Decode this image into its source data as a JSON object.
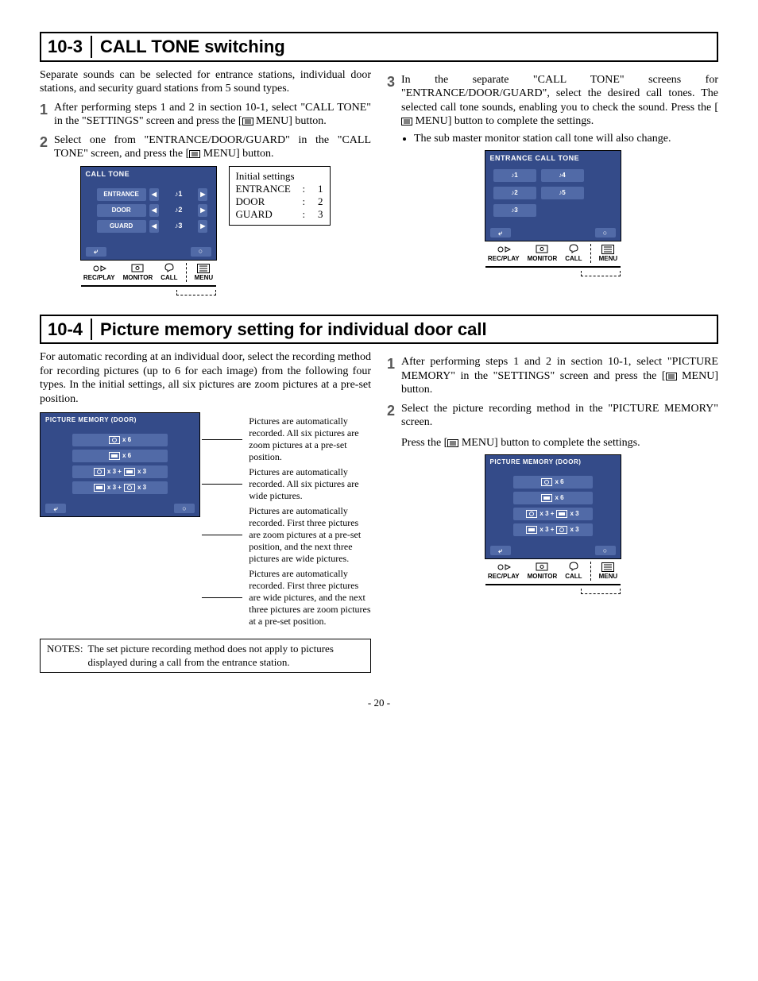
{
  "sec103": {
    "num": "10-3",
    "title": "CALL TONE switching",
    "intro": "Separate sounds can be selected for entrance stations, individual door stations, and security guard stations from 5 sound types.",
    "step1": "After performing steps 1 and 2 in section 10-1, select \"CALL TONE\" in the \"SETTINGS\" screen and press the [",
    "step1b": " MENU] button.",
    "step2a": "Select one from \"ENTRANCE/DOOR/GUARD\" in the \"CALL TONE\" screen, and press the [",
    "step2b": " MENU] button.",
    "step3a": "In the separate \"CALL TONE\" screens for \"ENTRANCE/DOOR/GUARD\", select the desired call tones. The selected call tone sounds, enabling you to check the sound. Press the [",
    "step3b": " MENU] button to complete the settings.",
    "step3bullet": "The sub master monitor station call tone will also change.",
    "ui1": {
      "title": "CALL TONE",
      "rows": [
        {
          "label": "ENTRANCE",
          "val": "♪1"
        },
        {
          "label": "DOOR",
          "val": "♪2"
        },
        {
          "label": "GUARD",
          "val": "♪3"
        }
      ]
    },
    "init": {
      "title": "Initial settings",
      "rows": [
        {
          "k": "ENTRANCE",
          "v": "1"
        },
        {
          "k": "DOOR",
          "v": "2"
        },
        {
          "k": "GUARD",
          "v": "3"
        }
      ]
    },
    "ui2": {
      "title": "ENTRANCE CALL TONE",
      "opts": [
        "♪1",
        "♪2",
        "♪3",
        "♪4",
        "♪5"
      ]
    }
  },
  "hw": {
    "rec": "REC/PLAY",
    "mon": "MONITOR",
    "call": "CALL",
    "menu": "MENU"
  },
  "sec104": {
    "num": "10-4",
    "title": "Picture memory setting for individual door call",
    "intro": "For automatic recording at an individual door, select the recording method for recording pictures (up to 6 for each image) from the following four types. In the initial settings, all six pictures are zoom pictures at a pre-set position.",
    "ui_title": "PICTURE MEMORY (DOOR)",
    "opts": {
      "a": "x 6",
      "b": "x 6",
      "c1": "x 3 +",
      "c2": "x 3",
      "d1": "x 3 +",
      "d2": "x 3"
    },
    "desc": {
      "a": "Pictures are automatically recorded. All six pictures are zoom pictures at a pre-set position.",
      "b": "Pictures are automatically recorded. All six pictures are wide pictures.",
      "c": "Pictures are automatically recorded. First three pictures are zoom pictures at a pre-set position, and the next three pictures are wide pictures.",
      "d": "Pictures are automatically recorded. First three pictures are wide pictures, and the next three pictures are zoom pictures at a pre-set position."
    },
    "notes_l": "NOTES:",
    "notes": "The set picture recording method does not apply to pictures displayed during a call from the entrance station.",
    "step1a": "After performing steps 1 and 2 in section 10-1, select \"PICTURE MEMORY\" in the \"SETTINGS\" screen and press the [",
    "step1b": " MENU] button.",
    "step2": "Select the picture recording method in the \"PICTURE MEMORY\" screen.",
    "step2a": "Press the [",
    "step2b": " MENU] button to complete the settings."
  },
  "page": "- 20 -"
}
